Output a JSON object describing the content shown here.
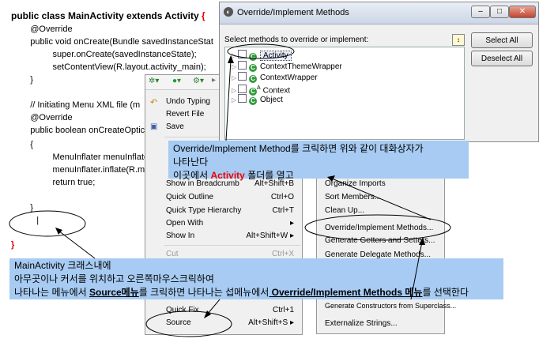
{
  "code": {
    "lines": [
      {
        "text": "public class MainActivity extends Activity ",
        "brace": "{"
      },
      {
        "text": "    @Override"
      },
      {
        "text": "    public void onCreate(Bundle savedInstanceStat"
      },
      {
        "text": "        super.onCreate(savedInstanceState);"
      },
      {
        "text": "        setContentView(R.layout.activity_main);"
      },
      {
        "text": "    }"
      },
      {
        "text": ""
      },
      {
        "text": "    // Initiating Menu XML file (m"
      },
      {
        "text": "    @Override"
      },
      {
        "text": "    public boolean onCreateOptic"
      },
      {
        "text": "    {"
      },
      {
        "text": "        MenuInflater menuInflater"
      },
      {
        "text": "        menuInflater.inflate(R.men"
      },
      {
        "text": "        return true;"
      },
      {
        "text": ""
      },
      {
        "text": "    }"
      },
      {
        "text": "    |"
      },
      {
        "text": ""
      },
      {
        "text": "}",
        "red": true
      }
    ]
  },
  "dialog": {
    "title": "Override/Implement Methods",
    "min_btn": "–",
    "max_btn": "□",
    "close_btn": "✕",
    "prompt": "Select methods to override or implement:",
    "select_all": "Select All",
    "deselect_all": "Deselect All",
    "tree": [
      {
        "label": "Activity",
        "selected": true,
        "badge": ""
      },
      {
        "label": "ContextThemeWrapper",
        "selected": false,
        "badge": ""
      },
      {
        "label": "ContextWrapper",
        "selected": false,
        "badge": ""
      },
      {
        "label": "Context",
        "selected": false,
        "badge": "A"
      },
      {
        "label": "Object",
        "selected": false,
        "badge": ""
      }
    ]
  },
  "context_menu": {
    "items": [
      {
        "label": "Undo Typing",
        "shortcut": "",
        "disabled": false
      },
      {
        "label": "Revert File",
        "shortcut": "",
        "disabled": false
      },
      {
        "label": "Save",
        "shortcut": "",
        "disabled": false
      },
      {
        "label": "Show in Breadcrumb",
        "shortcut": "Alt+Shift+B",
        "disabled": false
      },
      {
        "label": "Quick Outline",
        "shortcut": "Ctrl+O",
        "disabled": false
      },
      {
        "label": "Quick Type Hierarchy",
        "shortcut": "Ctrl+T",
        "disabled": false
      },
      {
        "label": "Open With",
        "shortcut": "▸",
        "disabled": false
      },
      {
        "label": "Show In",
        "shortcut": "Alt+Shift+W ▸",
        "disabled": false
      },
      {
        "label": "Cut",
        "shortcut": "Ctrl+X",
        "disabled": true
      },
      {
        "label": "Quick Fix",
        "shortcut": "Ctrl+1",
        "disabled": false
      },
      {
        "label": "Source",
        "shortcut": "Alt+Shift+S ▸",
        "disabled": false
      }
    ]
  },
  "submenu": {
    "items": [
      "Organize Imports",
      "Sort Members...",
      "Clean Up...",
      "Override/Implement Methods...",
      "Generate Getters and Setters...",
      "Generate Delegate Methods...",
      "Generate Constructors from Superclass...",
      "Externalize Strings..."
    ]
  },
  "callout_top": {
    "line1": "Override/Implement Method를 크릭하면 위와 같이 대화상자가",
    "line2": "나타난다",
    "line3_a": "이곳에서 ",
    "line3_b": "Activity",
    "line3_c": " 폴더를 열고"
  },
  "callout_bottom": {
    "line1": "MainActivity 크래스내에",
    "line2": "아무곳이나 커서를 위치하고 오른쪽마우스크릭하여",
    "line3_a": "나타나는 메뉴에서 ",
    "line3_b": "Source메뉴",
    "line3_c": "를 크릭하면 나타나는 섭메뉴에서",
    "line3_d": " Override/Implement Methods 메뉴",
    "line3_e": "를 선택한다"
  },
  "colors": {
    "callout": "#a7cbf2",
    "highlight": "#e00000",
    "class_icon": "#2f9a3b"
  }
}
